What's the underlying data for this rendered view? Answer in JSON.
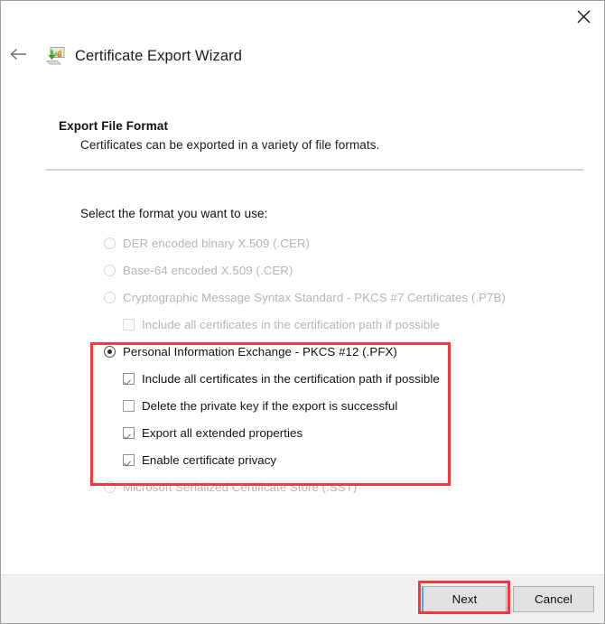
{
  "window": {
    "title": "Certificate Export Wizard",
    "icon": "certificate-export-icon",
    "close_icon": "close-icon",
    "back_icon": "back-arrow-icon"
  },
  "page": {
    "heading": "Export File Format",
    "subheading": "Certificates can be exported in a variety of file formats.",
    "prompt": "Select the format you want to use:"
  },
  "options": [
    {
      "id": "der",
      "control": "radio",
      "label": "DER encoded binary X.509 (.CER)",
      "checked": false,
      "enabled": false,
      "indent": 1
    },
    {
      "id": "base64",
      "control": "radio",
      "label": "Base-64 encoded X.509 (.CER)",
      "checked": false,
      "enabled": false,
      "indent": 1
    },
    {
      "id": "pkcs7",
      "control": "radio",
      "label": "Cryptographic Message Syntax Standard - PKCS #7 Certificates (.P7B)",
      "checked": false,
      "enabled": false,
      "indent": 1
    },
    {
      "id": "pkcs7-include-chain",
      "control": "checkbox",
      "label": "Include all certificates in the certification path if possible",
      "checked": false,
      "enabled": false,
      "indent": 2
    },
    {
      "id": "pfx",
      "control": "radio",
      "label": "Personal Information Exchange - PKCS #12 (.PFX)",
      "checked": true,
      "enabled": true,
      "indent": 1
    },
    {
      "id": "pfx-include-chain",
      "control": "checkbox",
      "label": "Include all certificates in the certification path if possible",
      "checked": true,
      "enabled": true,
      "indent": 2
    },
    {
      "id": "pfx-delete-key",
      "control": "checkbox",
      "label": "Delete the private key if the export is successful",
      "checked": false,
      "enabled": true,
      "indent": 2
    },
    {
      "id": "pfx-export-extended",
      "control": "checkbox",
      "label": "Export all extended properties",
      "checked": true,
      "enabled": true,
      "indent": 2
    },
    {
      "id": "pfx-enable-privacy",
      "control": "checkbox",
      "label": "Enable certificate privacy",
      "checked": true,
      "enabled": true,
      "indent": 2
    },
    {
      "id": "sst",
      "control": "radio",
      "label": "Microsoft Serialized Certificate Store (.SST)",
      "checked": false,
      "enabled": false,
      "indent": 1
    }
  ],
  "footer": {
    "next_label": "Next",
    "cancel_label": "Cancel"
  },
  "annotations": {
    "highlight_color": "#f5383f"
  }
}
